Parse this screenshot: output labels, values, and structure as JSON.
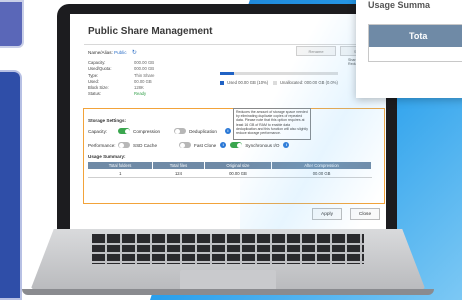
{
  "app": {
    "title": "Public Share Management",
    "share_label": "Name/Alias:",
    "share_value": "Public",
    "buttons": {
      "rename": "Rename",
      "other": "Settings"
    }
  },
  "share_info": [
    {
      "key": "Capacity:",
      "value": "000.00 GB"
    },
    {
      "key": "Used/Quota:",
      "value": "000.00 GB"
    },
    {
      "key": "Type:",
      "value": "Thin Share"
    },
    {
      "key": "Used:",
      "value": "00.00 GB"
    },
    {
      "key": "Block Size:",
      "value": "128K"
    },
    {
      "key": "Status:",
      "value": "Ready"
    }
  ],
  "usage_bar": {
    "used_fraction": 0.12,
    "color_used": "#2062c4",
    "color_free": "#dcdcdc"
  },
  "usage_legend": {
    "used": "Used 00.00 GB (10%)",
    "unallocated": "Unallocated: 000.00 GB (0.0%)"
  },
  "side_note": "Share Size / Data Reduction",
  "storage_settings": {
    "section_label": "Storage Settings:",
    "help_text": "Reduces the amount of storage space needed by eliminating duplicate copies of repeated data. Please note that this option requires at least 16 GB of RAM to enable data deduplication and this function will also slightly reduce storage performance.",
    "capacity_label": "Capacity:",
    "performance_label": "Performance:",
    "capacity_options": [
      {
        "label": "Compression",
        "on": true
      },
      {
        "label": "Deduplication",
        "on": false
      }
    ],
    "performance_options": [
      {
        "label": "SSD Cache",
        "on": false
      },
      {
        "label": "Fast Clone",
        "on": false
      },
      {
        "label": "Synchronous I/O",
        "on": true
      }
    ]
  },
  "usage_summary": {
    "label": "Usage Summary:",
    "columns": [
      "Total folders",
      "Total files",
      "Original size",
      "After Compression"
    ],
    "rows": [
      [
        "1",
        "124",
        "00.00 GB",
        "00.00 GB"
      ]
    ]
  },
  "footer": {
    "apply": "Apply",
    "close": "Close"
  },
  "floating_card": {
    "title": "Usage Summa",
    "header": "Tota"
  },
  "colors": {
    "accent_blue": "#2a78d6",
    "highlight_orange": "#f2a33a",
    "on_green": "#3aa64e",
    "header_slate": "#6f8aa6"
  }
}
